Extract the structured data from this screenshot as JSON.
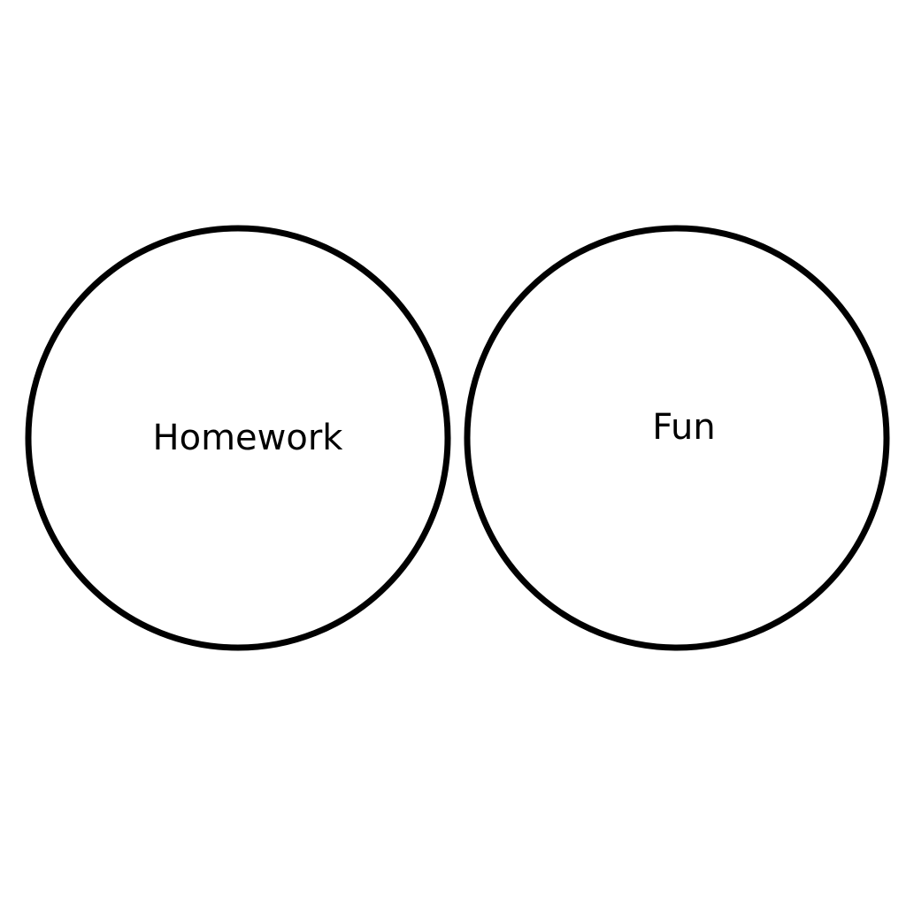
{
  "diagram": {
    "circles": [
      {
        "label": "Homework"
      },
      {
        "label": "Fun"
      }
    ],
    "colors": {
      "background": "#ffffff",
      "stroke": "#000000",
      "text": "#000000"
    }
  }
}
